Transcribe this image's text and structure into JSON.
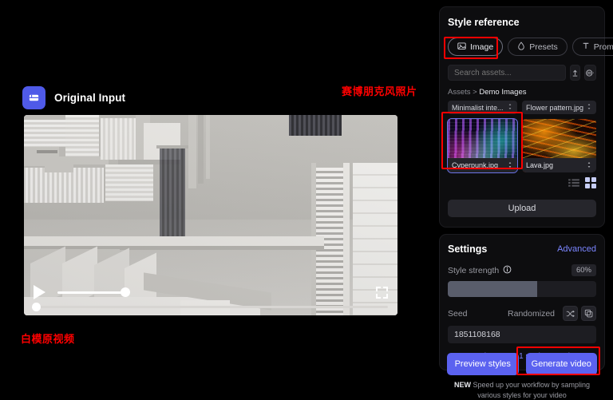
{
  "left": {
    "input_title": "Original Input",
    "input_icon": "video-clip-icon",
    "annotation_top": "赛博朋克风照片",
    "annotation_bottom": "白模原视频",
    "player": {
      "play_icon": "play-icon",
      "fullscreen_icon": "fullscreen-icon",
      "volume_percent": 100,
      "progress_percent": 0
    }
  },
  "style_reference": {
    "title": "Style reference",
    "tabs": [
      {
        "label": "Image",
        "icon": "image-icon",
        "active": true
      },
      {
        "label": "Presets",
        "icon": "droplet-icon",
        "active": false
      },
      {
        "label": "Prompt",
        "icon": "text-t-icon",
        "active": false
      }
    ],
    "search": {
      "placeholder": "Search assets...",
      "value": ""
    },
    "search_actions": [
      {
        "name": "upload-asset-icon"
      },
      {
        "name": "filter-sort-icon"
      }
    ],
    "breadcrumb": {
      "root": "Assets",
      "separator": ">",
      "current": "Demo Images"
    },
    "assets": [
      {
        "name": "Minimalist inte...",
        "kind": "pill"
      },
      {
        "name": "Flower pattern.jpg",
        "kind": "pill"
      },
      {
        "name": "Cyperpunk.jpg",
        "kind": "thumb",
        "selected": true,
        "style": "cyber"
      },
      {
        "name": "Lava.jpg",
        "kind": "thumb",
        "selected": false,
        "style": "lava"
      }
    ],
    "view_modes": [
      {
        "name": "list-view-icon",
        "active": false
      },
      {
        "name": "grid-view-icon",
        "active": true
      }
    ],
    "upload_label": "Upload"
  },
  "settings": {
    "title": "Settings",
    "advanced_label": "Advanced",
    "style_strength": {
      "label": "Style strength",
      "info_icon": "info-icon",
      "value_label": "60%",
      "value": 60
    },
    "seed": {
      "label": "Seed",
      "mode_label": "Randomized",
      "value": "1851108168",
      "shuffle_icon": "shuffle-icon",
      "copy_icon": "copy-icon"
    },
    "learn_link": "Learn how Gen-1 settings work  →"
  },
  "actions": {
    "preview_label": "Preview styles",
    "generate_label": "Generate video",
    "footnote_badge": "NEW",
    "footnote_text": " Speed up your workflow by sampling various styles for your video"
  },
  "colors": {
    "accent": "#5b62f0",
    "link": "#7b85ff",
    "annotation": "#ff0000",
    "panel": "#0d0d0f"
  }
}
